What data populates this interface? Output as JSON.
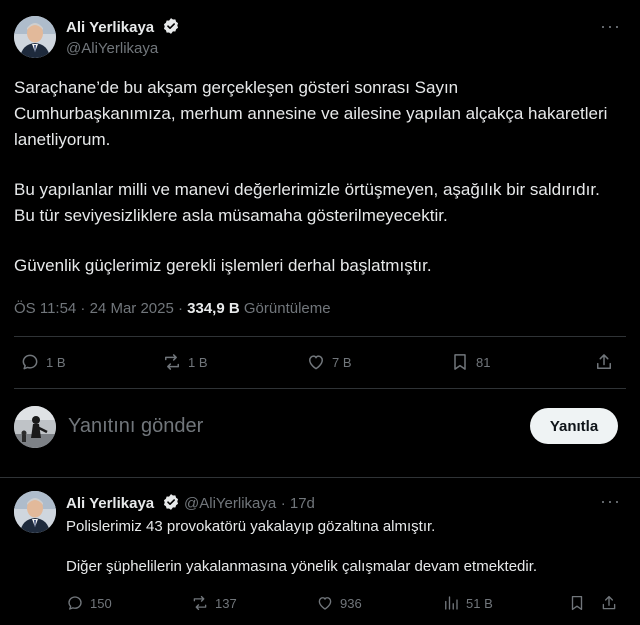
{
  "tweet": {
    "author_name": "Ali Yerlikaya",
    "author_handle": "@AliYerlikaya",
    "paragraphs": [
      "Saraçhane’de bu akşam gerçekleşen gösteri sonrası Sayın Cumhurbaşkanımıza, merhum annesine ve ailesine yapılan alçakça hakaretleri lanetliyorum.",
      "Bu yapılanlar milli ve manevi değerlerimizle örtüşmeyen, aşağılık bir saldırıdır. Bu tür seviyesizliklere asla müsamaha gösterilmeyecektir.",
      "Güvenlik güçlerimiz gerekli işlemleri derhal başlatmıştır."
    ],
    "timestamp": "ÖS 11:54 · 24 Mar 2025 ·",
    "views_count": "334,9 B",
    "views_label": "Görüntüleme",
    "actions": {
      "replies": "1 B",
      "retweets": "1 B",
      "likes": "7 B",
      "bookmarks": "81"
    }
  },
  "reply_box": {
    "placeholder": "Yanıtını gönder",
    "button_label": "Yanıtla"
  },
  "reply_tweet": {
    "author_name": "Ali Yerlikaya",
    "author_handle": "@AliYerlikaya",
    "time": "· 17d",
    "paragraphs": [
      "Polislerimiz 43 provokatörü yakalayıp gözaltına almıştır.",
      "Diğer şüphelilerin yakalanmasına yönelik çalışmalar devam etmektedir."
    ],
    "actions": {
      "replies": "150",
      "retweets": "137",
      "likes": "936",
      "views": "51 B"
    }
  },
  "colors": {
    "background": "#000000",
    "text": "#e7e9ea",
    "muted": "#71767b",
    "verified": "#1d9bf0",
    "divider": "#2f3336"
  },
  "icons": [
    "verified-badge-icon",
    "more-icon",
    "reply-icon",
    "retweet-icon",
    "like-icon",
    "bookmark-icon",
    "share-icon",
    "views-icon"
  ]
}
